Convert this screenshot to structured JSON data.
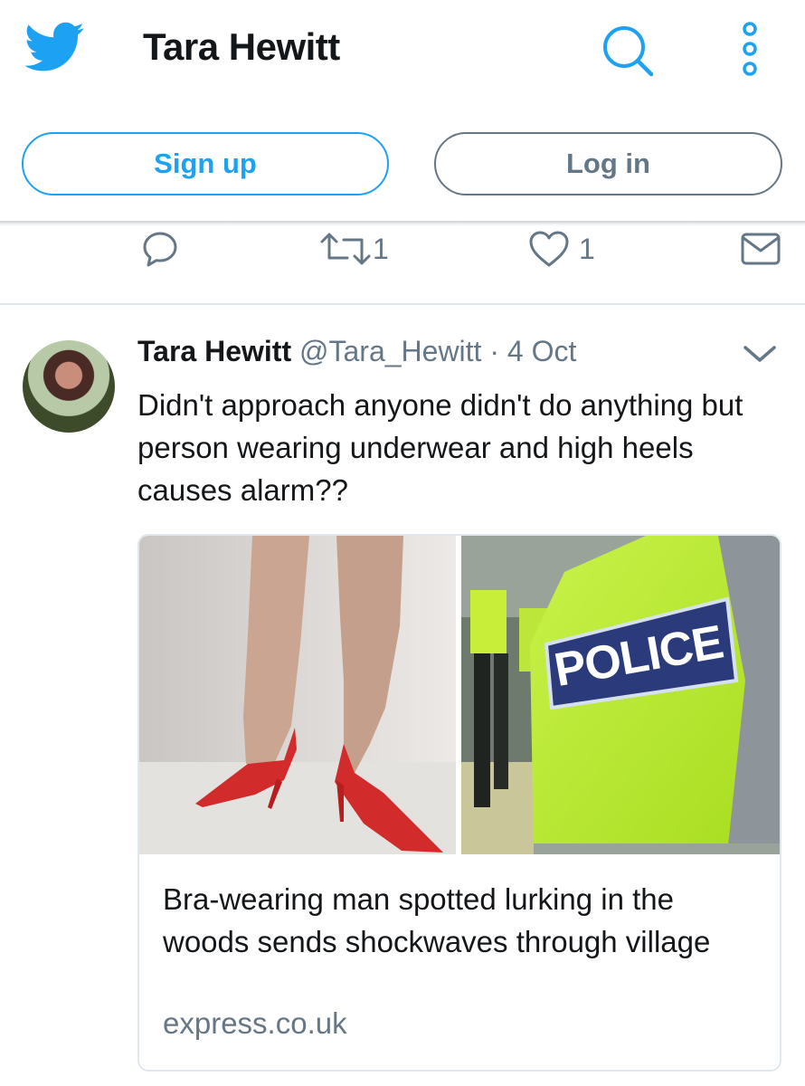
{
  "header": {
    "logo_icon": "twitter-bird-icon",
    "title": "Tara Hewitt",
    "search_icon": "search-icon",
    "more_icon": "more-vertical-icon"
  },
  "auth": {
    "signup_label": "Sign up",
    "login_label": "Log in"
  },
  "colors": {
    "brand": "#1da1f2",
    "muted": "#657786",
    "text": "#14171a",
    "border": "#e1e8ed"
  },
  "previous_tweet_actions": {
    "reply_icon": "reply-icon",
    "retweet_icon": "retweet-icon",
    "retweet_count": "1",
    "like_icon": "heart-icon",
    "like_count": "1",
    "dm_icon": "envelope-icon"
  },
  "tweet": {
    "author_name": "Tara Hewitt",
    "handle": "@Tara_Hewitt",
    "separator": "·",
    "date": "4 Oct",
    "menu_icon": "chevron-down-icon",
    "text": "Didn't approach anyone didn't do anything but person wearing underwear and high heels causes alarm??",
    "card": {
      "image_text": "POLICE",
      "title": "Bra-wearing man spotted lurking in the woods sends shockwaves through village",
      "domain": "express.co.uk"
    }
  }
}
